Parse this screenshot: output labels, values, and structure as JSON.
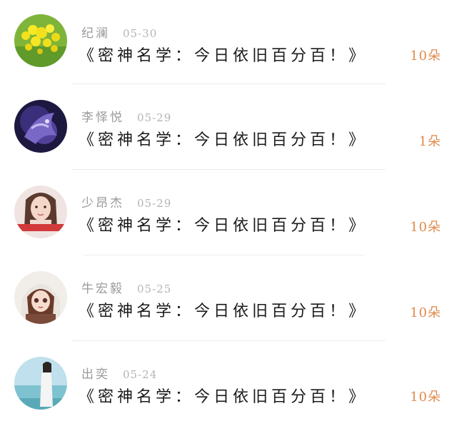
{
  "records": [
    {
      "name": "纪澜",
      "date": "05-30",
      "message": "《密神名学：今日依旧百分百！》",
      "amount": "10朵",
      "avatar": "yellow-flowers-avatar"
    },
    {
      "name": "李怿悦",
      "date": "05-29",
      "message": "《密神名学：今日依旧百分百！》",
      "amount": "1朵",
      "avatar": "purple-dragon-avatar"
    },
    {
      "name": "少昂杰",
      "date": "05-29",
      "message": "《密神名学：今日依旧百分百！》",
      "amount": "10朵",
      "avatar": "girl-portrait-avatar"
    },
    {
      "name": "牛宏毅",
      "date": "05-25",
      "message": "《密神名学：今日依旧百分百！》",
      "amount": "10朵",
      "avatar": "anime-doll-avatar"
    },
    {
      "name": "出奕",
      "date": "05-24",
      "message": "《密神名学：今日依旧百分百！》",
      "amount": "10朵",
      "avatar": "seaside-girl-avatar"
    }
  ],
  "colors": {
    "amount": "#e08a4c",
    "name": "#9a9a9a",
    "message": "#1a1a1a",
    "divider": "#ececec"
  }
}
